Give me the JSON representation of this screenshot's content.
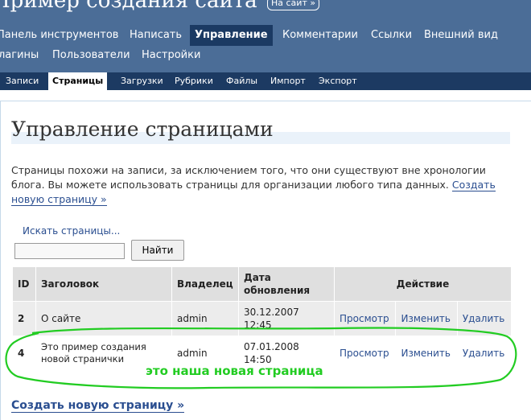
{
  "header": {
    "site_title": "Пример создания сайта",
    "visit_site": "На сайт »"
  },
  "main_menu": {
    "row1": [
      "Панель инструментов",
      "Написать",
      "Управление",
      "Комментарии",
      "Ссылки",
      "Внешний вид"
    ],
    "row2": [
      "лагины",
      "Пользователи",
      "Настройки"
    ],
    "active": "Управление"
  },
  "sub_menu": {
    "items": [
      "Записи",
      "Страницы",
      "Загрузки",
      "Рубрики",
      "Файлы",
      "Импорт",
      "Экспорт"
    ],
    "active": "Страницы"
  },
  "page": {
    "heading": "Управление страницами",
    "intro": "Страницы похожи на записи, за исключением того, что они существуют вне хронологии блога. Вы можете использовать страницы для организации любого типа данных.",
    "intro_link": "Создать новую страницу »"
  },
  "search": {
    "label": "Искать страницы...",
    "input_value": "",
    "button": "Найти"
  },
  "table": {
    "headers": {
      "id": "ID",
      "title": "Заголовок",
      "owner": "Владелец",
      "date": "Дата обновления",
      "action": "Действие"
    },
    "rows": [
      {
        "id": "2",
        "title": "О сайте",
        "owner": "admin",
        "date": "30.12.2007 12:45",
        "view": "Просмотр",
        "edit": "Изменить",
        "delete": "Удалить"
      },
      {
        "id": "4",
        "title": "Это пример создания новой странички",
        "owner": "admin",
        "date": "07.01.2008 14:50",
        "view": "Просмотр",
        "edit": "Изменить",
        "delete": "Удалить"
      }
    ]
  },
  "create_link": "Создать новую страницу »",
  "annotation": {
    "text": "это наша новая страница",
    "color": "#22cc22"
  },
  "colors": {
    "header_bg": "#4b6d97",
    "submenu_bg": "#1c3a62",
    "link": "#2a4e90"
  }
}
